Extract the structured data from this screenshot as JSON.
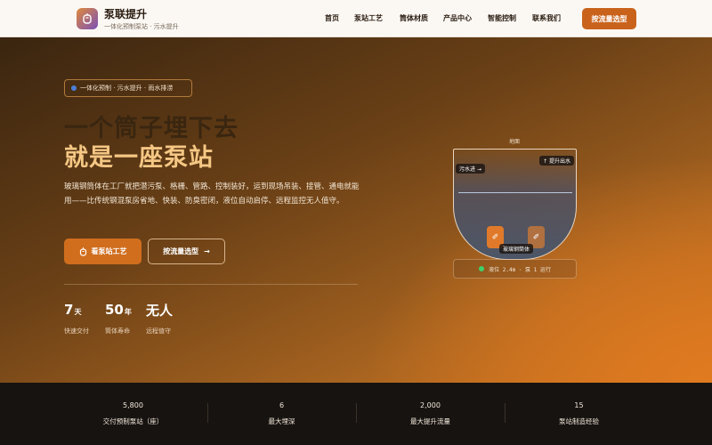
{
  "header": {
    "brand_name": "泵联提升",
    "brand_sub": "一体化预制泵站 · 污水提升",
    "nav": [
      "首页",
      "泵站工艺",
      "筒体材质",
      "产品中心",
      "智能控制",
      "联系我们"
    ],
    "cta": "按流量选型"
  },
  "hero": {
    "pill": "一体化预制 · 污水提升 · 雨水排涝",
    "title_line1": "一个筒子埋下去",
    "title_line2": "就是一座泵站",
    "description": "玻璃钢筒体在工厂就把潜污泵、格栅、管路、控制装好，运到现场吊装、接管、通电就能用——比传统钢混泵房省地、快装、防臭密闭，液位自动启停、远程监控无人值守。",
    "btn_primary": "看泵站工艺",
    "btn_secondary": "按流量选型",
    "stats": [
      {
        "num": "7",
        "unit": "天",
        "label": "快速交付"
      },
      {
        "num": "50",
        "unit": "年",
        "label": "筒体寿命"
      },
      {
        "num": "无人",
        "unit": "",
        "label": "远程值守"
      }
    ]
  },
  "diagram": {
    "ground": "地面",
    "inlet": "污水进 →",
    "outlet": "↑ 提升出水",
    "tank_label": "玻璃钢筒体",
    "status": "液位 2.4m · 泵 1 运行"
  },
  "bottom_stats": [
    {
      "num": "5,800",
      "label": "交付预制泵站（座）"
    },
    {
      "num": "6",
      "label": "最大埋深"
    },
    {
      "num": "2,000",
      "label": "最大提升流量"
    },
    {
      "num": "15",
      "label": "泵站制造经验"
    }
  ],
  "colors": {
    "accent": "#c9631c",
    "title_highlight": "#f5c784",
    "status_ok": "#3fd06a"
  }
}
